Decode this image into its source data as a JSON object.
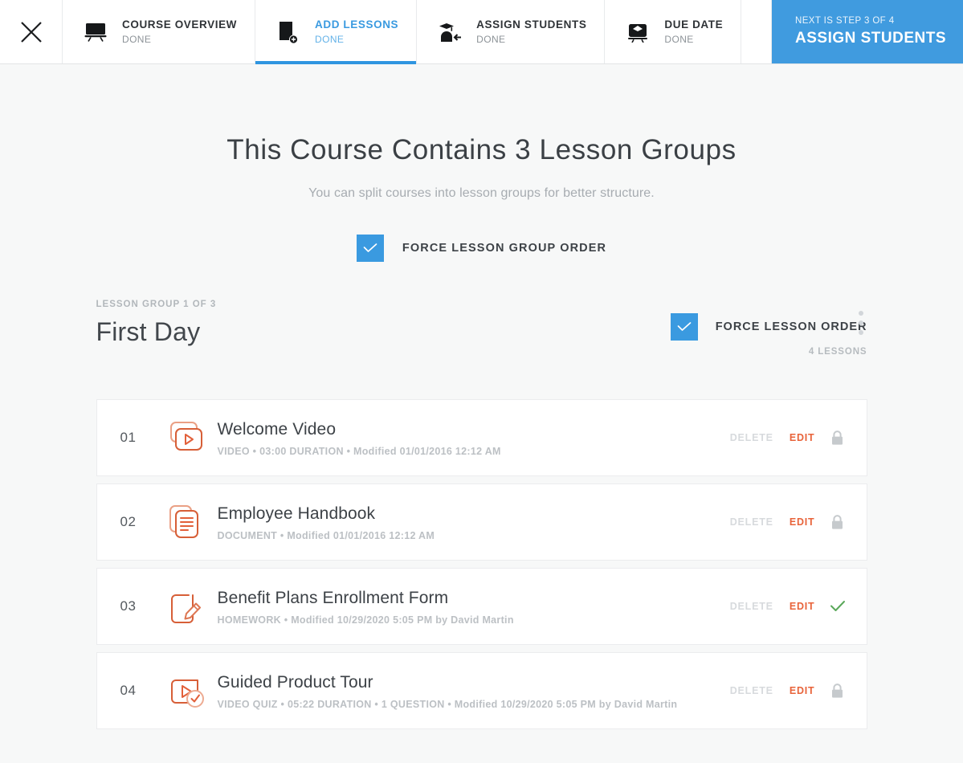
{
  "wizard": {
    "close_label": "close-x",
    "steps": [
      {
        "icon": "whiteboard-icon",
        "title": "COURSE OVERVIEW",
        "status": "DONE",
        "active": false
      },
      {
        "icon": "add-lesson-icon",
        "title": "ADD LESSONS",
        "status": "DONE",
        "active": true
      },
      {
        "icon": "assign-students-icon",
        "title": "ASSIGN STUDENTS",
        "status": "DONE",
        "active": false
      },
      {
        "icon": "due-date-icon",
        "title": "DUE DATE",
        "status": "DONE",
        "active": false
      }
    ],
    "next": {
      "eyebrow": "NEXT IS STEP 3 OF 4",
      "label": "ASSIGN STUDENTS",
      "color": "#409bdf"
    }
  },
  "main": {
    "title": "This Course Contains 3 Lesson Groups",
    "subtitle": "You can split courses into lesson groups for better structure.",
    "force_group_order": {
      "label": "FORCE LESSON GROUP ORDER",
      "checked": true,
      "color": "#3a9ae0"
    }
  },
  "lesson_group": {
    "eyebrow": "LESSON GROUP 1 OF 3",
    "name": "First Day",
    "force_lesson_order": {
      "label": "FORCE LESSON ORDER",
      "checked": true
    },
    "lesson_count": "4 LESSONS",
    "menu_icon": "kebab-menu-icon"
  },
  "actions": {
    "delete_label": "DELETE",
    "edit_label": "EDIT",
    "edit_color": "#e8633a"
  },
  "lessons": [
    {
      "num": "01",
      "icon": "video-icon",
      "title": "Welcome Video",
      "meta": "VIDEO • 03:00 DURATION • Modified 01/01/2016 12:12 AM",
      "state": "lock-icon"
    },
    {
      "num": "02",
      "icon": "document-icon",
      "title": "Employee Handbook",
      "meta": "DOCUMENT • Modified 01/01/2016 12:12 AM",
      "state": "lock-icon"
    },
    {
      "num": "03",
      "icon": "homework-icon",
      "title": "Benefit Plans Enrollment Form",
      "meta": "HOMEWORK • Modified 10/29/2020 5:05 PM by David Martin",
      "state": "check-icon"
    },
    {
      "num": "04",
      "icon": "video-quiz-icon",
      "title": "Guided Product Tour",
      "meta": "VIDEO QUIZ • 05:22 DURATION • 1 QUESTION • Modified 10/29/2020 5:05 PM by David Martin",
      "state": "lock-icon"
    }
  ]
}
